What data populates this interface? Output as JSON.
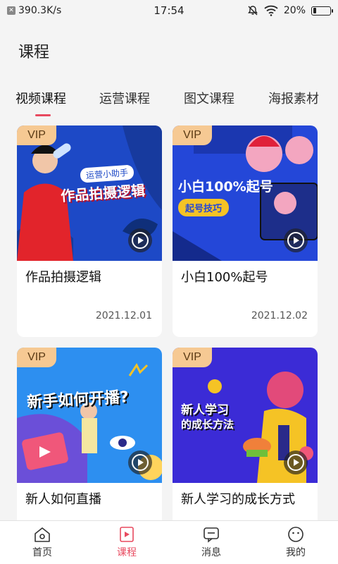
{
  "status_bar": {
    "net_speed": "390.3K/s",
    "time": "17:54",
    "battery": "20%",
    "battery_level": 0.2
  },
  "header": {
    "title": "课程"
  },
  "tabs": [
    {
      "label": "视频课程",
      "active": true
    },
    {
      "label": "运营课程",
      "active": false
    },
    {
      "label": "图文课程",
      "active": false
    },
    {
      "label": "海报素材",
      "active": false
    }
  ],
  "cards": [
    {
      "badge": "VIP",
      "banner_text": "作品拍摄逻辑",
      "banner_sub": "运营小助手",
      "title": "作品拍摄逻辑",
      "date": "2021.12.01"
    },
    {
      "badge": "VIP",
      "banner_text": "小白100%起号",
      "banner_sub": "起号技巧",
      "title": "小白100%起号",
      "date": "2021.12.02"
    },
    {
      "badge": "VIP",
      "banner_text": "新手如何开播?",
      "title": "新人如何直播",
      "date": ""
    },
    {
      "badge": "VIP",
      "banner_text": "新人学习",
      "banner_sub": "的成长方法",
      "title": "新人学习的成长方式",
      "date": ""
    }
  ],
  "bottom_nav": [
    {
      "label": "首页",
      "icon": "home-icon",
      "active": false
    },
    {
      "label": "课程",
      "icon": "course-icon",
      "active": true
    },
    {
      "label": "消息",
      "icon": "message-icon",
      "active": false
    },
    {
      "label": "我的",
      "icon": "profile-icon",
      "active": false
    }
  ],
  "colors": {
    "accent": "#e84a5f",
    "vip_badge": "#f6c993"
  }
}
